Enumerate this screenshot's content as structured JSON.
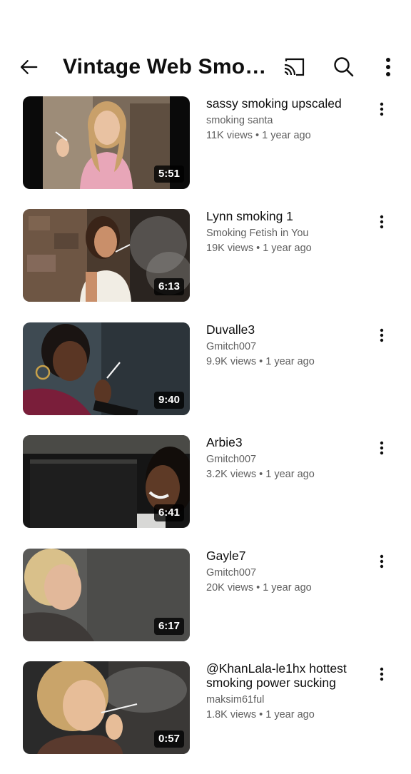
{
  "header": {
    "title": "Vintage Web Smoki...",
    "back_icon": "arrow-left-icon",
    "cast_icon": "cast-icon",
    "search_icon": "search-icon",
    "more_icon": "more-vert-icon"
  },
  "videos": [
    {
      "title": "sassy smoking upscaled",
      "channel": "smoking santa",
      "stats": "11K views • 1 year ago",
      "duration": "5:51"
    },
    {
      "title": "Lynn smoking 1",
      "channel": "Smoking Fetish in You",
      "stats": "19K views • 1 year ago",
      "duration": "6:13"
    },
    {
      "title": "Duvalle3",
      "channel": "Gmitch007",
      "stats": "9.9K views • 1 year ago",
      "duration": "9:40"
    },
    {
      "title": "Arbie3",
      "channel": "Gmitch007",
      "stats": "3.2K views • 1 year ago",
      "duration": "6:41"
    },
    {
      "title": "Gayle7",
      "channel": "Gmitch007",
      "stats": "20K views • 1 year ago",
      "duration": "6:17"
    },
    {
      "title": "@KhanLala-le1hx hottest smoking power sucking",
      "channel": "maksim61ful",
      "stats": "1.8K views • 1 year ago",
      "duration": "0:57"
    }
  ]
}
